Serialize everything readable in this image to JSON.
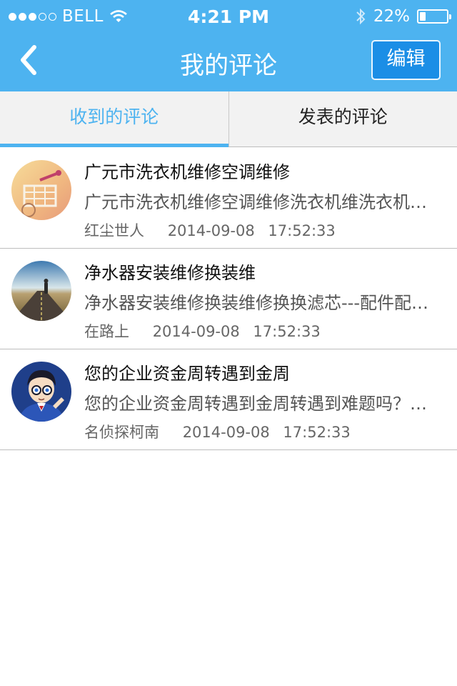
{
  "status_bar": {
    "carrier": "BELL",
    "time": "4:21 PM",
    "battery_text": "22%",
    "battery_level": 0.22,
    "signal_dots_filled": 3,
    "signal_dots_total": 5
  },
  "nav": {
    "title": "我的评论",
    "edit_label": "编辑"
  },
  "tabs": [
    {
      "label": "收到的评论",
      "active": true
    },
    {
      "label": "发表的评论",
      "active": false
    }
  ],
  "comments": [
    {
      "title": "广元市洗衣机维修空调维修",
      "preview": "广元市洗衣机维修空调维修洗衣机维洗衣机维修",
      "author": "红尘世人",
      "date": "2014-09-08",
      "time": "17:52:33"
    },
    {
      "title": "净水器安装维修换装维",
      "preview": "净水器安装维修换装维修换换滤芯---配件配件配件",
      "author": "在路上",
      "date": "2014-09-08",
      "time": "17:52:33"
    },
    {
      "title": "您的企业资金周转遇到金周",
      "preview": "您的企业资金周转遇到金周转遇到难题吗？难题吗",
      "author": "名侦探柯南",
      "date": "2014-09-08",
      "time": "17:52:33"
    }
  ],
  "colors": {
    "header": "#4db3f0",
    "edit_button": "#1b8ee6",
    "active_tab": "#4db3f0"
  }
}
